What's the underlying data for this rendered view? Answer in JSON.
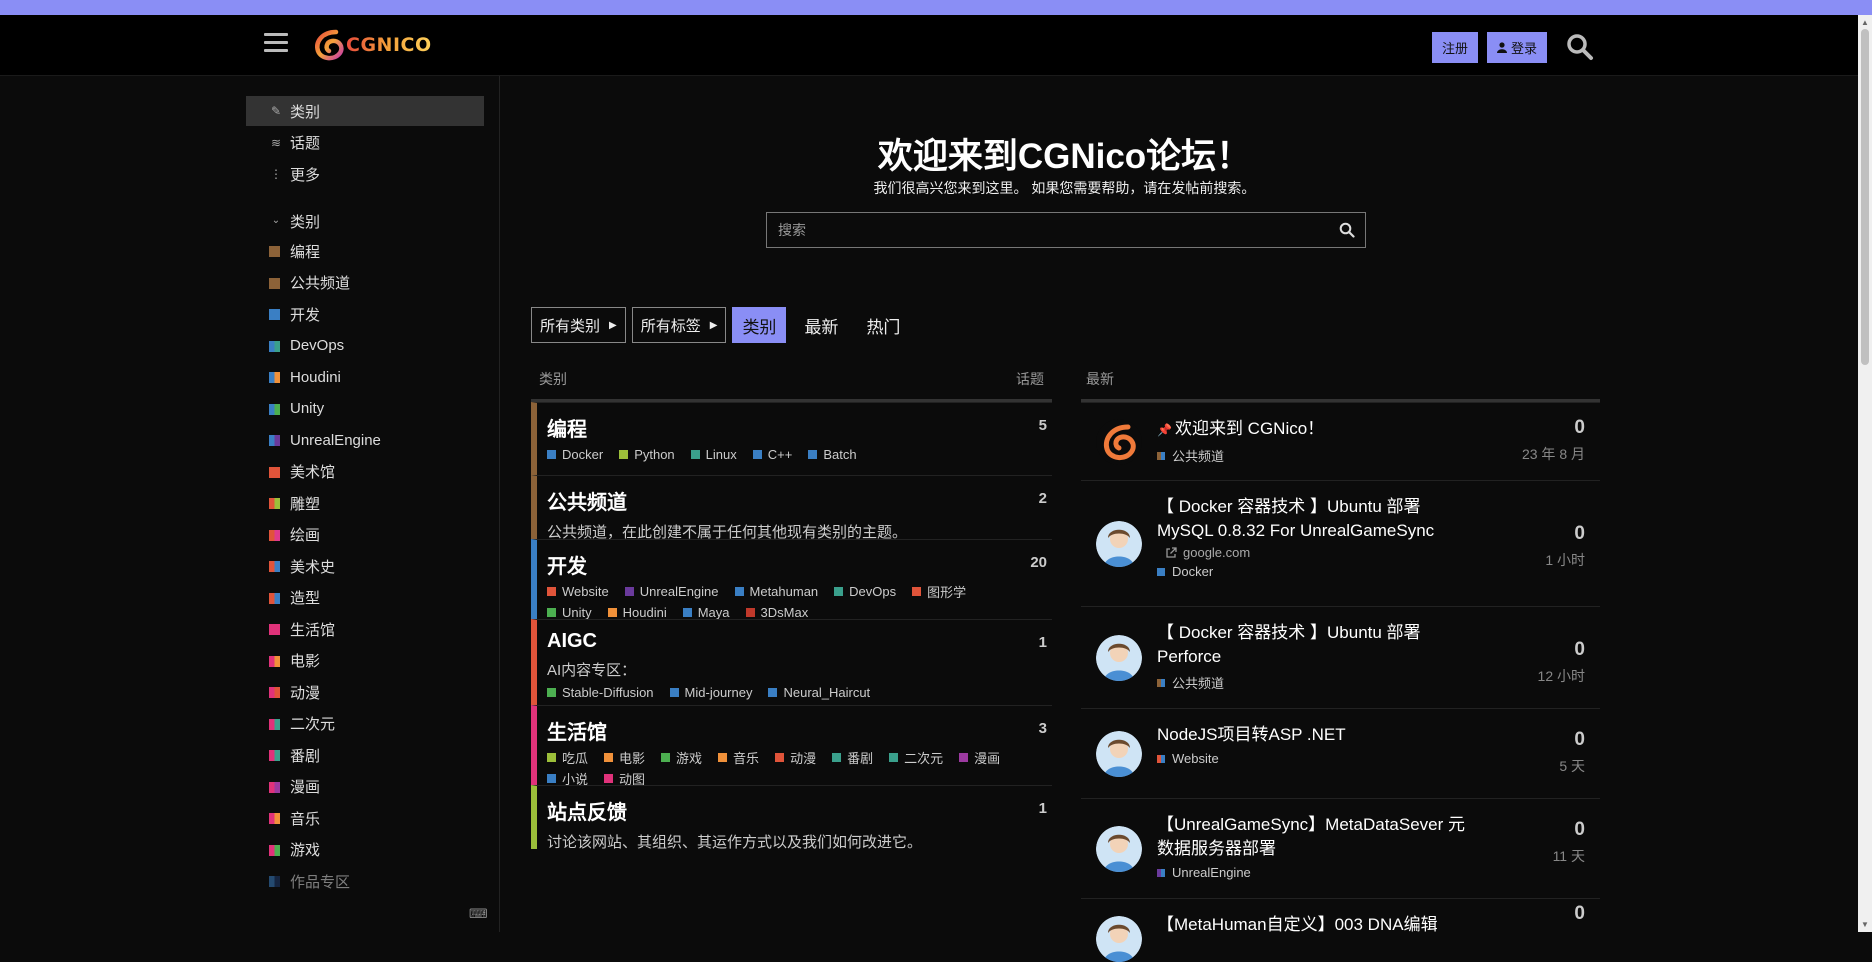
{
  "header": {
    "logo_text": "CGNICO",
    "register": "注册",
    "login": "登录"
  },
  "sidebar": {
    "nav": [
      {
        "label": "类别",
        "icon": "pencil-ruler-icon"
      },
      {
        "label": "话题",
        "icon": "layers-icon"
      },
      {
        "label": "更多",
        "icon": "more-vertical-icon"
      }
    ],
    "section_title": "类别",
    "categories": [
      {
        "label": "编程",
        "colors": [
          "#8c6238",
          "#8c6238"
        ]
      },
      {
        "label": "公共频道",
        "colors": [
          "#8c6238",
          "#8c6238"
        ]
      },
      {
        "label": "开发",
        "colors": [
          "#3a7fc4",
          "#3a7fc4"
        ]
      },
      {
        "label": "DevOps",
        "colors": [
          "#3a7fc4",
          "#3aa08c"
        ]
      },
      {
        "label": "Houdini",
        "colors": [
          "#3a7fc4",
          "#f0913a"
        ]
      },
      {
        "label": "Unity",
        "colors": [
          "#3a7fc4",
          "#4caf50"
        ]
      },
      {
        "label": "UnrealEngine",
        "colors": [
          "#3a7fc4",
          "#6a3a9c"
        ]
      },
      {
        "label": "美术馆",
        "colors": [
          "#e0543a",
          "#e0543a"
        ]
      },
      {
        "label": "雕塑",
        "colors": [
          "#e0543a",
          "#9cbf3a"
        ]
      },
      {
        "label": "绘画",
        "colors": [
          "#e0543a",
          "#e03a8c"
        ]
      },
      {
        "label": "美术史",
        "colors": [
          "#e0543a",
          "#3a7fc4"
        ]
      },
      {
        "label": "造型",
        "colors": [
          "#e0543a",
          "#3a7fc4"
        ]
      },
      {
        "label": "生活馆",
        "colors": [
          "#e0327a",
          "#e0327a"
        ]
      },
      {
        "label": "电影",
        "colors": [
          "#e0327a",
          "#f0913a"
        ]
      },
      {
        "label": "动漫",
        "colors": [
          "#e0327a",
          "#e0543a"
        ]
      },
      {
        "label": "二次元",
        "colors": [
          "#e0327a",
          "#3aa08c"
        ]
      },
      {
        "label": "番剧",
        "colors": [
          "#e0327a",
          "#3aa08c"
        ]
      },
      {
        "label": "漫画",
        "colors": [
          "#e0327a",
          "#9c3aa0"
        ]
      },
      {
        "label": "音乐",
        "colors": [
          "#e0327a",
          "#f0913a"
        ]
      },
      {
        "label": "游戏",
        "colors": [
          "#e0327a",
          "#4caf50"
        ]
      },
      {
        "label": "作品专区",
        "colors": [
          "#3a7fc4",
          "#1e3a6a"
        ]
      }
    ]
  },
  "welcome": {
    "title": "欢迎来到CGNico论坛！",
    "subtitle": "我们很高兴您来到这里。 如果您需要帮助，请在发帖前搜索。",
    "search_placeholder": "搜索"
  },
  "navbar": {
    "all_categories": "所有类别",
    "all_tags": "所有标签",
    "tabs": [
      "类别",
      "最新",
      "热门"
    ]
  },
  "table_headers": {
    "category": "类别",
    "topics": "话题",
    "latest": "最新"
  },
  "categories": [
    {
      "name": "编程",
      "count": "5",
      "color": "#8c6238",
      "desc": "",
      "subs": [
        {
          "n": "Docker",
          "c": "#3a7fc4"
        },
        {
          "n": "Python",
          "c": "#9cbf3a"
        },
        {
          "n": "Linux",
          "c": "#3aa08c"
        },
        {
          "n": "C++",
          "c": "#3a7fc4"
        },
        {
          "n": "Batch",
          "c": "#3a7fc4"
        }
      ]
    },
    {
      "name": "公共频道",
      "count": "2",
      "color": "#8c6238",
      "desc": "公共频道，在此创建不属于任何其他现有类别的主题。",
      "subs": []
    },
    {
      "name": "开发",
      "count": "20",
      "color": "#3a7fc4",
      "desc": "",
      "subs": [
        {
          "n": "Website",
          "c": "#e0543a"
        },
        {
          "n": "UnrealEngine",
          "c": "#6a3a9c"
        },
        {
          "n": "Metahuman",
          "c": "#3a7fc4"
        },
        {
          "n": "DevOps",
          "c": "#3aa08c"
        },
        {
          "n": "图形学",
          "c": "#e0543a"
        },
        {
          "n": "Unity",
          "c": "#4caf50"
        },
        {
          "n": "Houdini",
          "c": "#f0913a"
        },
        {
          "n": "Maya",
          "c": "#3a7fc4"
        },
        {
          "n": "3DsMax",
          "c": "#c0392b"
        }
      ]
    },
    {
      "name": "AIGC",
      "count": "1",
      "color": "#e0543a",
      "desc": "AI内容专区：",
      "subs": [
        {
          "n": "Stable-Diffusion",
          "c": "#4caf50"
        },
        {
          "n": "Mid-journey",
          "c": "#3a7fc4"
        },
        {
          "n": "Neural_Haircut",
          "c": "#3a7fc4"
        }
      ]
    },
    {
      "name": "生活馆",
      "count": "3",
      "color": "#e0327a",
      "desc": "",
      "subs": [
        {
          "n": "吃瓜",
          "c": "#9cbf3a"
        },
        {
          "n": "电影",
          "c": "#f0913a"
        },
        {
          "n": "游戏",
          "c": "#4caf50"
        },
        {
          "n": "音乐",
          "c": "#f0913a"
        },
        {
          "n": "动漫",
          "c": "#e0543a"
        },
        {
          "n": "番剧",
          "c": "#3aa08c"
        },
        {
          "n": "二次元",
          "c": "#3aa08c"
        },
        {
          "n": "漫画",
          "c": "#9c3aa0"
        },
        {
          "n": "小说",
          "c": "#3a7fc4"
        },
        {
          "n": "动图",
          "c": "#e0327a"
        }
      ]
    },
    {
      "name": "站点反馈",
      "count": "1",
      "color": "#9cbf3a",
      "desc": "讨论该网站、其组织、其运作方式以及我们如何改进它。",
      "subs": []
    }
  ],
  "latest": [
    {
      "title": "欢迎来到 CGNico！",
      "pinned": true,
      "cat": "公共频道",
      "cat_color": "#8c6238",
      "link": "",
      "count": "0",
      "time": "23 年 8 月",
      "avatar": "logo"
    },
    {
      "title": "【 Docker 容器技术 】Ubuntu 部署 MySQL 0.8.32 For UnrealGameSync",
      "pinned": false,
      "cat": "Docker",
      "cat_color": "#3a7fc4",
      "link": "google.com",
      "count": "0",
      "time": "1 小时",
      "avatar": "user"
    },
    {
      "title": "【 Docker 容器技术 】Ubuntu 部署 Perforce",
      "pinned": false,
      "cat": "公共频道",
      "cat_color": "#8c6238",
      "link": "",
      "count": "0",
      "time": "12 小时",
      "avatar": "user"
    },
    {
      "title": "NodeJS项目转ASP .NET",
      "pinned": false,
      "cat": "Website",
      "cat_color": "#e0543a",
      "link": "",
      "count": "0",
      "time": "5 天",
      "avatar": "user"
    },
    {
      "title": "【UnrealGameSync】MetaDataSever 元数据服务器部署",
      "pinned": false,
      "cat": "UnrealEngine",
      "cat_color": "#6a3a9c",
      "link": "",
      "count": "0",
      "time": "11 天",
      "avatar": "user"
    },
    {
      "title": "【MetaHuman自定义】003 DNA编辑",
      "pinned": false,
      "cat": "",
      "cat_color": "#3a7fc4",
      "link": "",
      "count": "0",
      "time": "",
      "avatar": "user"
    }
  ]
}
